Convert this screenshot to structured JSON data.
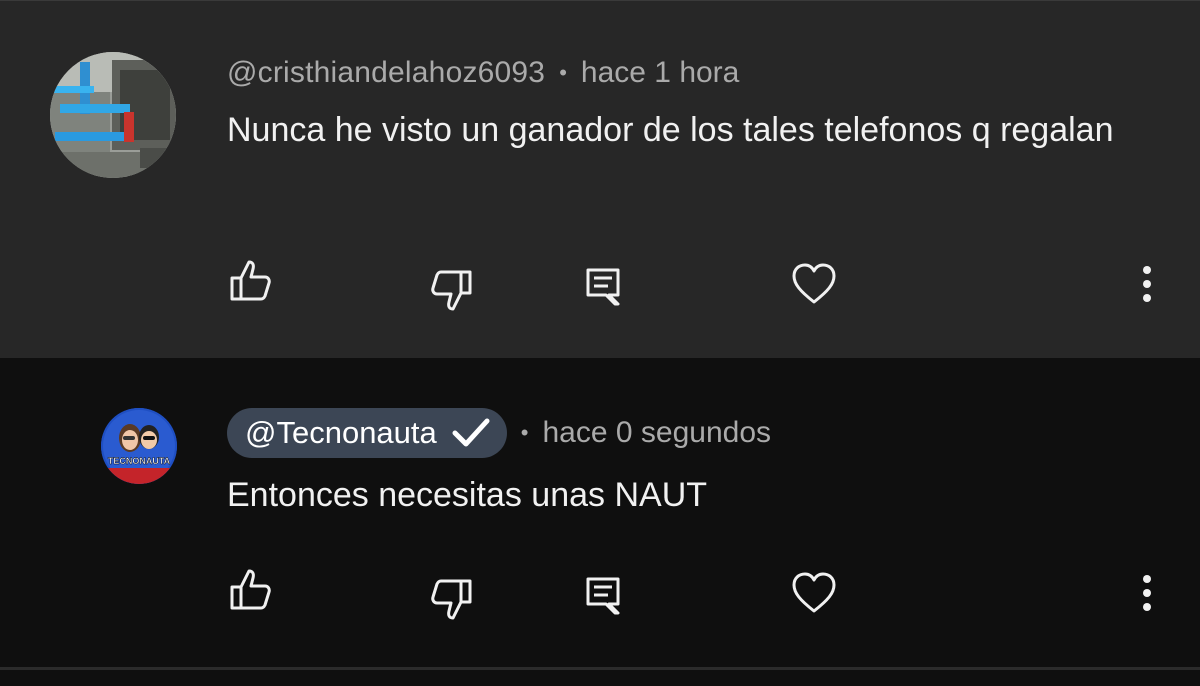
{
  "comments": [
    {
      "author": "@cristhiandelahoz6093",
      "separator": "•",
      "time": "hace 1 hora",
      "text": "Nunca he visto un ganador de los tales telefonos q regalan",
      "avatar_icon": "industrial-photo-avatar",
      "actions": [
        "like-icon",
        "dislike-icon",
        "reply-icon",
        "heart-icon",
        "more-vert-icon"
      ]
    },
    {
      "author": "@Tecnonauta",
      "author_is_owner": true,
      "verified": true,
      "separator": "•",
      "time": "hace 0 segundos",
      "text": "Entonces necesitas unas NAUT",
      "avatar_label": "TECNONAUTA",
      "actions": [
        "like-icon",
        "dislike-icon",
        "reply-icon",
        "heart-icon",
        "more-vert-icon"
      ]
    }
  ],
  "colors": {
    "top_comment_bg": "#272727",
    "reply_bg": "#0f0f0f",
    "owner_pill_bg": "#3c4655",
    "text_primary": "#f1f1f1",
    "text_secondary": "#aaaaaa"
  }
}
